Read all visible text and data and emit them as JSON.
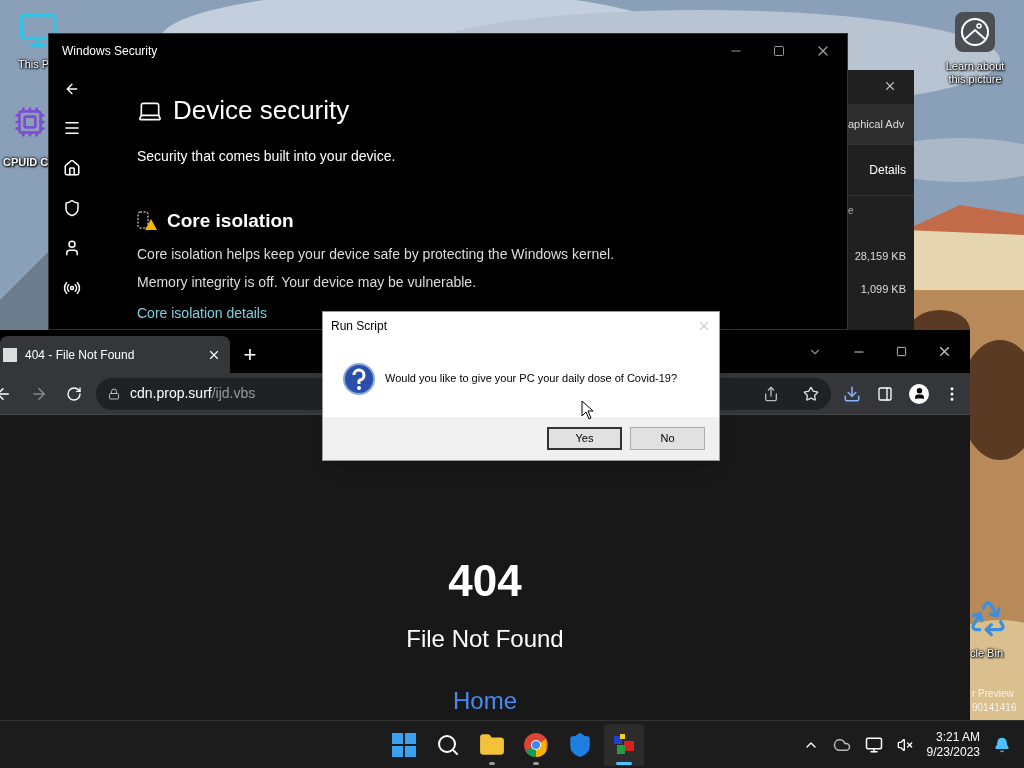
{
  "desktop": {
    "icons": [
      {
        "kind": "monitor",
        "label": "This P"
      },
      {
        "kind": "chip",
        "label": "CPUID C"
      },
      {
        "kind": "landscape",
        "label": "Learn about this picture"
      },
      {
        "kind": "recycle",
        "label": "cle Bin"
      }
    ],
    "build_text": [
      "r Preview",
      "90141416"
    ]
  },
  "task_manager": {
    "tab": "aphical Adv",
    "button": "Details",
    "column": "e",
    "values": [
      "28,159 KB",
      "1,099 KB"
    ]
  },
  "security_window": {
    "title": "Windows Security",
    "heading": "Device security",
    "subtitle": "Security that comes built into your device.",
    "section": {
      "title": "Core isolation",
      "description": "Core isolation helps keep your device safe by protecting the Windows kernel.",
      "status": "Memory integrity is off. Your device may be vulnerable.",
      "link": "Core isolation details"
    }
  },
  "browser": {
    "tabs": [
      {
        "title": "404 - File Not Found",
        "selected": true
      }
    ],
    "new_tab": "+",
    "url_host": "cdn.prop.surf",
    "url_path": "/ijd.vbs",
    "page": {
      "code": "404",
      "message": "File Not Found",
      "link": "Home"
    }
  },
  "dialog": {
    "title": "Run Script",
    "message": "Would you like to give your PC your daily dose of Covid-19?",
    "buttons": [
      {
        "label": "Yes",
        "selected": true
      },
      {
        "label": "No",
        "selected": false
      }
    ]
  },
  "taskbar": {
    "apps": [
      {
        "kind": "start",
        "running": false,
        "selected": false
      },
      {
        "kind": "search",
        "running": false,
        "selected": false
      },
      {
        "kind": "folder",
        "running": true,
        "selected": false
      },
      {
        "kind": "chrome",
        "running": true,
        "selected": false
      },
      {
        "kind": "shield",
        "running": false,
        "selected": false
      },
      {
        "kind": "script",
        "running": true,
        "selected": true
      }
    ],
    "time": "3:21 AM",
    "date": "9/23/2023"
  }
}
